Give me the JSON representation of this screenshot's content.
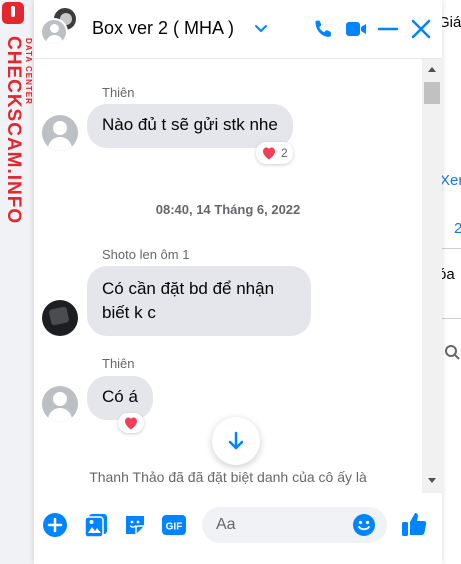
{
  "watermark": {
    "brand": "CHECKSCAM.INFO",
    "subtitle": "DATA CENTER"
  },
  "background_page": {
    "texts": [
      "Giá",
      "Xen",
      "2",
      "óa"
    ]
  },
  "header": {
    "title": "Box ver 2 ( MHA )",
    "icons": [
      "chevron-down-icon",
      "phone-icon",
      "video-camera-icon",
      "minimize-icon",
      "close-icon"
    ],
    "accent_color": "#0084ff"
  },
  "messages": [
    {
      "sender": "Thiên",
      "text": "Nào đủ t sẽ gửi stk nhe",
      "reaction": {
        "emoji": "heart",
        "count": "2"
      }
    },
    {
      "timestamp": "08:40, 14 Tháng 6, 2022"
    },
    {
      "sender": "Shoto len ôm 1",
      "lines": [
        "Có cần đặt bd để nhận",
        "biết k c"
      ]
    },
    {
      "sender": "Thiên",
      "text": "Có á",
      "reaction": {
        "emoji": "heart"
      }
    }
  ],
  "system_message": "Thanh Thảo đã đã đặt biệt danh của cô ấy là",
  "composer": {
    "placeholder": "Aa",
    "icons": [
      "plus-circle-icon",
      "photo-icon",
      "sticker-icon",
      "gif-icon",
      "emoji-icon",
      "thumbs-up-icon"
    ],
    "gif_label": "GIF"
  },
  "colors": {
    "accent": "#0084ff",
    "bubble": "#e4e6eb",
    "heart": "#f33e58",
    "watermark": "#e4262f"
  }
}
